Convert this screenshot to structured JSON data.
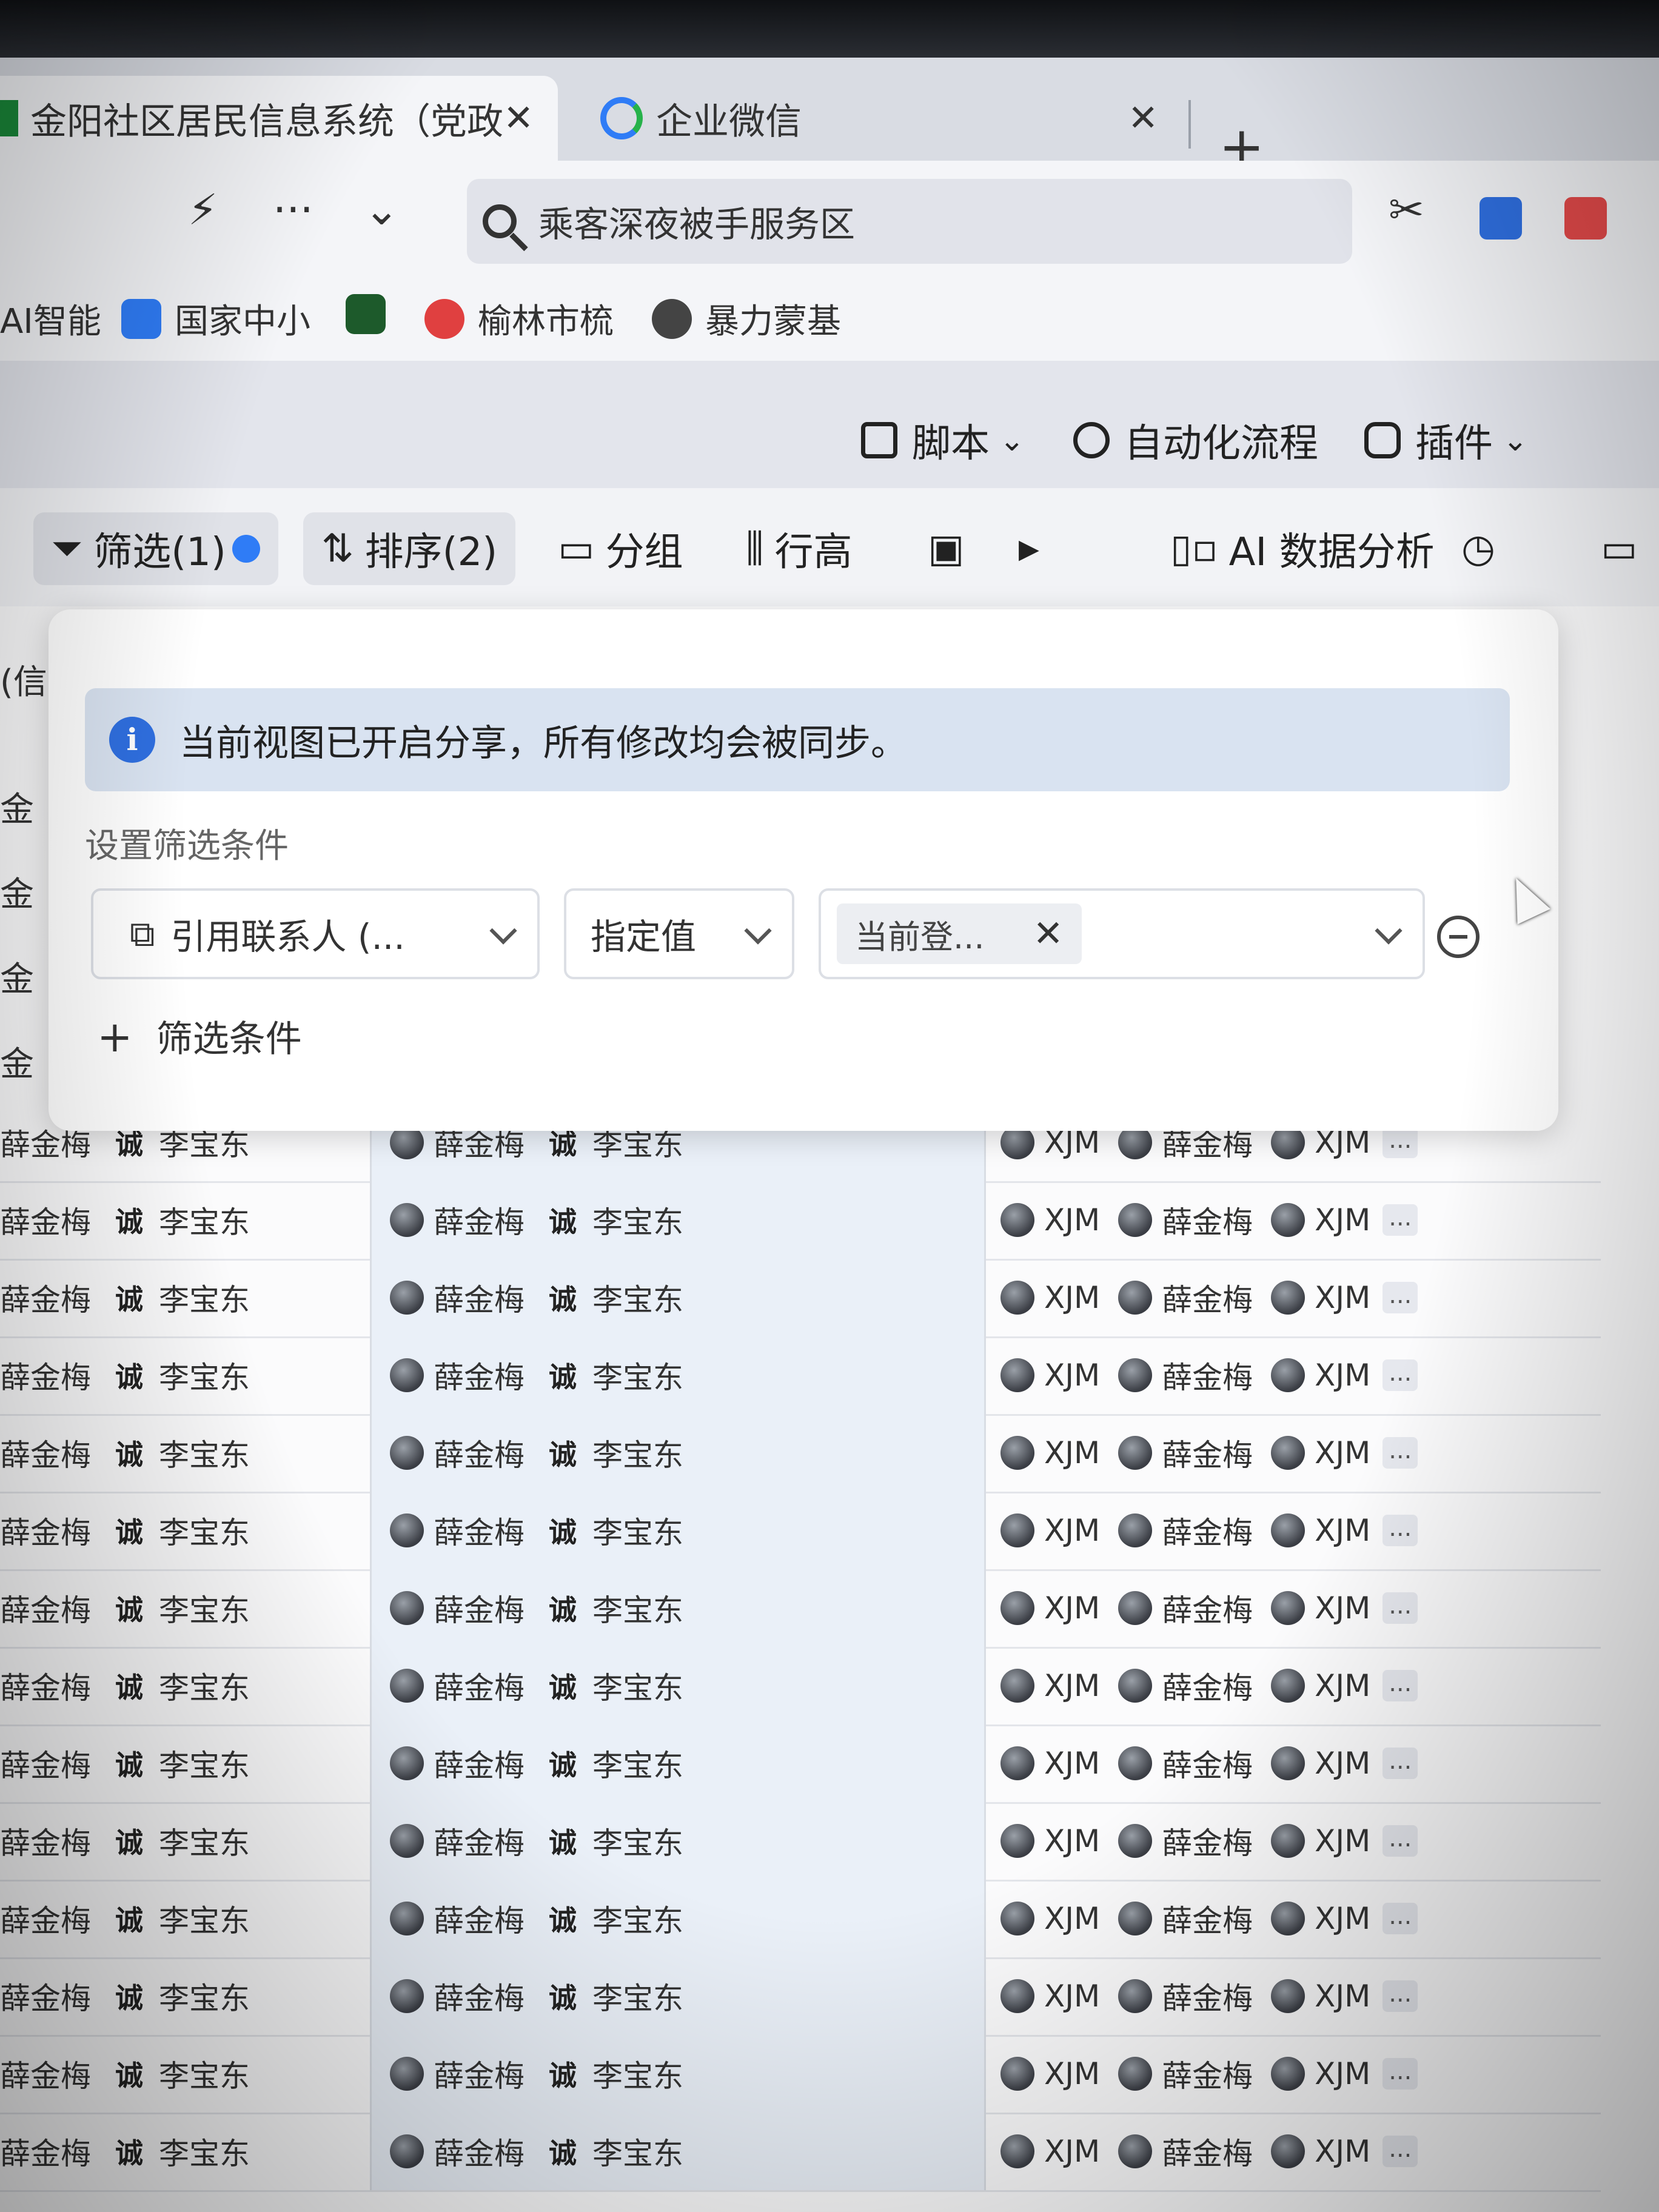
{
  "browser": {
    "tabs": [
      {
        "title": "金阳社区居民信息系统（党政",
        "active": true
      },
      {
        "title": "企业微信",
        "active": false
      }
    ],
    "new_tab": "+",
    "search_text": "乘客深夜被手服务区",
    "bookmarks": [
      "AI智能",
      "国家中小",
      "",
      "榆林市梳",
      "暴力蒙基"
    ]
  },
  "app_header": {
    "script_label": "脚本",
    "automation_label": "自动化流程",
    "plugin_label": "插件"
  },
  "toolbar": {
    "filter_label": "筛选(1)",
    "sort_label": "排序(2)",
    "group_label": "分组",
    "row_height_label": "行高",
    "ai_label": "AI 数据分析"
  },
  "filter_popup": {
    "notice": "当前视图已开启分享，所有修改均会被同步。",
    "section_label": "设置筛选条件",
    "field_select": "引用联系人 (...",
    "operator_select": "指定值",
    "value_chip": "当前登...",
    "add_condition": "筛选条件"
  },
  "grid": {
    "left_partial_labels": [
      "(信",
      "金",
      "金",
      "金",
      "金"
    ],
    "rows": [
      {
        "a1": "薛金梅",
        "a2": "李宝东",
        "b1": "薛金梅",
        "b2": "李宝东",
        "c1": "XJM",
        "c2": "薛金梅",
        "c3": "XJM"
      },
      {
        "a1": "薛金梅",
        "a2": "李宝东",
        "b1": "薛金梅",
        "b2": "李宝东",
        "c1": "XJM",
        "c2": "薛金梅",
        "c3": "XJM"
      },
      {
        "a1": "薛金梅",
        "a2": "李宝东",
        "b1": "薛金梅",
        "b2": "李宝东",
        "c1": "XJM",
        "c2": "薛金梅",
        "c3": "XJM"
      },
      {
        "a1": "薛金梅",
        "a2": "李宝东",
        "b1": "薛金梅",
        "b2": "李宝东",
        "c1": "XJM",
        "c2": "薛金梅",
        "c3": "XJM"
      },
      {
        "a1": "薛金梅",
        "a2": "李宝东",
        "b1": "薛金梅",
        "b2": "李宝东",
        "c1": "XJM",
        "c2": "薛金梅",
        "c3": "XJM"
      },
      {
        "a1": "薛金梅",
        "a2": "李宝东",
        "b1": "薛金梅",
        "b2": "李宝东",
        "c1": "XJM",
        "c2": "薛金梅",
        "c3": "XJM"
      },
      {
        "a1": "薛金梅",
        "a2": "李宝东",
        "b1": "薛金梅",
        "b2": "李宝东",
        "c1": "XJM",
        "c2": "薛金梅",
        "c3": "XJM"
      },
      {
        "a1": "薛金梅",
        "a2": "李宝东",
        "b1": "薛金梅",
        "b2": "李宝东",
        "c1": "XJM",
        "c2": "薛金梅",
        "c3": "XJM"
      },
      {
        "a1": "薛金梅",
        "a2": "李宝东",
        "b1": "薛金梅",
        "b2": "李宝东",
        "c1": "XJM",
        "c2": "薛金梅",
        "c3": "XJM"
      },
      {
        "a1": "薛金梅",
        "a2": "李宝东",
        "b1": "薛金梅",
        "b2": "李宝东",
        "c1": "XJM",
        "c2": "薛金梅",
        "c3": "XJM"
      },
      {
        "a1": "薛金梅",
        "a2": "李宝东",
        "b1": "薛金梅",
        "b2": "李宝东",
        "c1": "XJM",
        "c2": "薛金梅",
        "c3": "XJM"
      },
      {
        "a1": "薛金梅",
        "a2": "李宝东",
        "b1": "薛金梅",
        "b2": "李宝东",
        "c1": "XJM",
        "c2": "薛金梅",
        "c3": "XJM"
      },
      {
        "a1": "薛金梅",
        "a2": "李宝东",
        "b1": "薛金梅",
        "b2": "李宝东",
        "c1": "XJM",
        "c2": "薛金梅",
        "c3": "XJM"
      },
      {
        "a1": "薛金梅",
        "a2": "李宝东",
        "b1": "薛金梅",
        "b2": "李宝东",
        "c1": "XJM",
        "c2": "薛金梅",
        "c3": "XJM"
      }
    ],
    "row_prefix_glyph": "诚",
    "more_glyph": "..."
  },
  "colors": {
    "accent": "#2f7cf6",
    "notice_bg": "#d9e3f1",
    "selected_column": "#eaf0f8"
  }
}
